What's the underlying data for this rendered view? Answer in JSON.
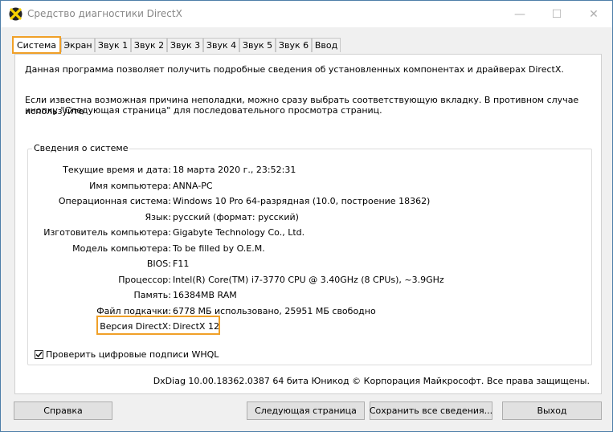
{
  "window": {
    "title": "Средство диагностики DirectX",
    "minimize": "—",
    "maximize": "☐",
    "close": "✕"
  },
  "tabs": [
    "Система",
    "Экран",
    "Звук 1",
    "Звук 2",
    "Звук 3",
    "Звук 4",
    "Звук 5",
    "Звук 6",
    "Ввод"
  ],
  "intro": {
    "line1": "Данная программа позволяет получить подробные сведения об установленных компонентах и драйверах DirectX.",
    "line2": "Если известна возможная причина неполадки, можно сразу выбрать соответствующую вкладку. В противном случае используйте",
    "line3": "кнопку \"Следующая страница\" для последовательного просмотра страниц."
  },
  "sysinfo": {
    "title": "Сведения о системе",
    "rows": [
      {
        "label": "Текущие время и дата:",
        "value": "18 марта 2020 г., 23:52:31"
      },
      {
        "label": "Имя компьютера:",
        "value": "ANNA-PC"
      },
      {
        "label": "Операционная система:",
        "value": "Windows 10 Pro 64-разрядная (10.0, построение 18362)"
      },
      {
        "label": "Язык:",
        "value": "русский (формат: русский)"
      },
      {
        "label": "Изготовитель компьютера:",
        "value": "Gigabyte Technology Co., Ltd."
      },
      {
        "label": "Модель компьютера:",
        "value": "To be filled by O.E.M."
      },
      {
        "label": "BIOS:",
        "value": "F11"
      },
      {
        "label": "Процессор:",
        "value": "Intel(R) Core(TM) i7-3770 CPU @ 3.40GHz (8 CPUs), ~3.9GHz"
      },
      {
        "label": "Память:",
        "value": "16384MB RAM"
      },
      {
        "label": "Файл подкачки:",
        "value": "6778 МБ использовано, 25951 МБ свободно"
      },
      {
        "label": "Версия DirectX:",
        "value": "DirectX 12"
      }
    ],
    "whql_label": "Проверить цифровые подписи WHQL",
    "whql_checked": true
  },
  "footer": "DxDiag 10.00.18362.0387 64 бита Юникод © Корпорация Майкрософт. Все права защищены.",
  "buttons": {
    "help": "Справка",
    "next": "Следующая страница",
    "save": "Сохранить все сведения...",
    "exit": "Выход"
  },
  "colors": {
    "highlight": "#f0a028"
  }
}
